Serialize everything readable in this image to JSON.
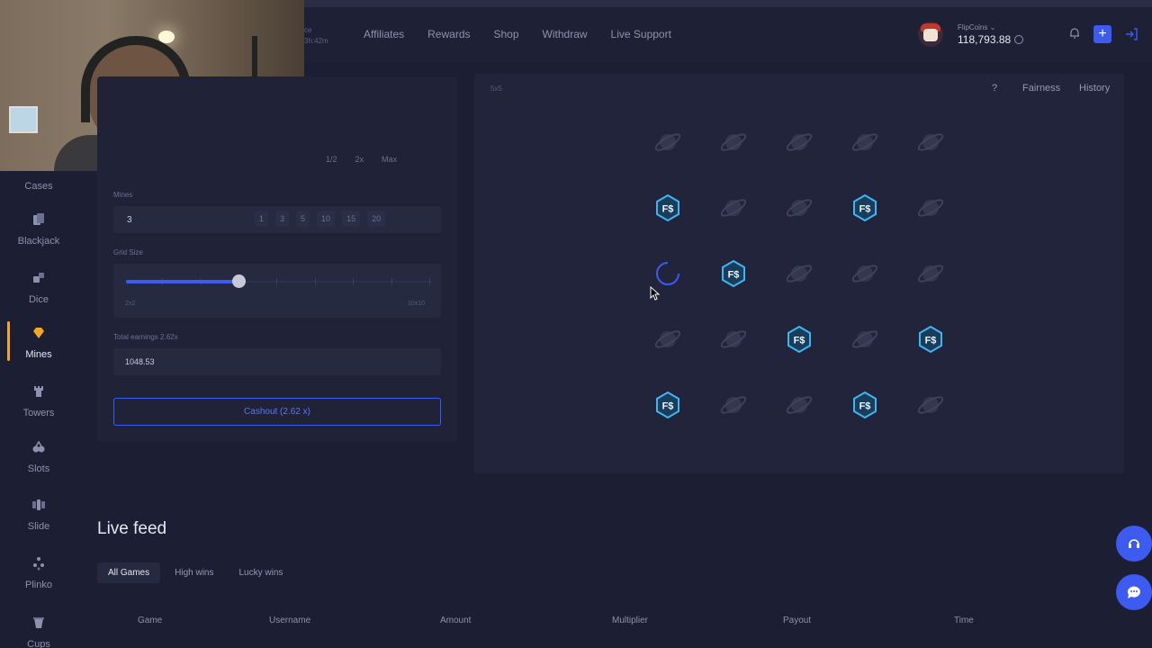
{
  "nav": {
    "items": [
      "Affiliates",
      "Rewards",
      "Shop",
      "Withdraw",
      "Live Support"
    ],
    "partial_text": [
      "ce",
      "3h:42m"
    ]
  },
  "wallet": {
    "label": "FlipCoins",
    "amount": "118,793.88"
  },
  "sidebar": {
    "items": [
      {
        "label": "Cases",
        "icon": "cases-icon"
      },
      {
        "label": "Blackjack",
        "icon": "cards-icon"
      },
      {
        "label": "Dice",
        "icon": "dice-icon"
      },
      {
        "label": "Mines",
        "icon": "diamond-icon"
      },
      {
        "label": "Towers",
        "icon": "tower-icon"
      },
      {
        "label": "Slots",
        "icon": "slots-icon"
      },
      {
        "label": "Slide",
        "icon": "slide-icon"
      },
      {
        "label": "Plinko",
        "icon": "plinko-icon"
      },
      {
        "label": "Cups",
        "icon": "cups-icon"
      }
    ],
    "active": "Mines",
    "accent": "#f5a623"
  },
  "bet_panel": {
    "quick_buttons": [
      "1/2",
      "2x",
      "Max"
    ],
    "mines_label": "Mines",
    "mines_value": "3",
    "mines_options": [
      "1",
      "3",
      "5",
      "10",
      "15",
      "20"
    ],
    "grid_label": "Grid Size",
    "grid_min": "2x2",
    "grid_max": "10x10",
    "grid_fraction": 0.375,
    "earnings_label": "Total earnings 2.62x",
    "earnings_value": "1048.53",
    "cashout_label": "Cashout (2.62 x)"
  },
  "board": {
    "size_label": "5x5",
    "help": "?",
    "fairness": "Fairness",
    "history": "History",
    "cells": [
      [
        "hidden",
        "hidden",
        "hidden",
        "hidden",
        "hidden"
      ],
      [
        "coin",
        "hidden",
        "hidden",
        "coin",
        "hidden"
      ],
      [
        "loading",
        "coin",
        "hidden",
        "hidden",
        "hidden"
      ],
      [
        "hidden",
        "hidden",
        "coin",
        "hidden",
        "coin"
      ],
      [
        "coin",
        "hidden",
        "hidden",
        "coin",
        "hidden"
      ]
    ],
    "coin_text": "F$",
    "coin_color": "#3fb6f2"
  },
  "feed": {
    "title": "Live feed",
    "tabs": [
      "All Games",
      "High wins",
      "Lucky wins"
    ],
    "columns": [
      "Game",
      "Username",
      "Amount",
      "Multiplier",
      "Payout",
      "Time"
    ]
  },
  "colors": {
    "brand_blue": "#3d5af1",
    "background": "#1c1f33"
  }
}
